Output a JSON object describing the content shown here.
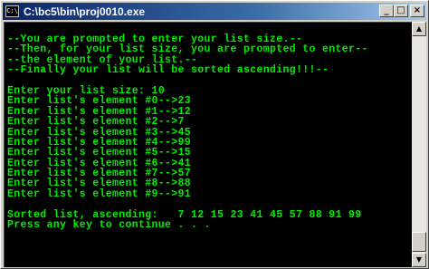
{
  "window": {
    "title": "C:\\bc5\\bin\\proj0010.exe",
    "icon": "C:\\",
    "buttons": {
      "minimize": "_",
      "maximize": "□",
      "close": "×"
    }
  },
  "console": {
    "text_color": "#00ee00",
    "background": "#000000",
    "lines": [
      "--You are prompted to enter your list size.--",
      "--Then, for your list size, you are prompted to enter--",
      "--the element of your list.--",
      "--Finally your list will be sorted ascending!!!--",
      "",
      "Enter your list size: 10",
      "Enter list's element #0-->23",
      "Enter list's element #1-->12",
      "Enter list's element #2-->7",
      "Enter list's element #3-->45",
      "Enter list's element #4-->99",
      "Enter list's element #5-->15",
      "Enter list's element #6-->41",
      "Enter list's element #7-->57",
      "Enter list's element #8-->88",
      "Enter list's element #9-->91",
      "",
      "Sorted list, ascending:   7 12 15 23 41 45 57 88 91 99",
      "Press any key to continue . . ."
    ]
  },
  "scrollbar": {
    "up_arrow": "▲",
    "down_arrow": "▼"
  }
}
